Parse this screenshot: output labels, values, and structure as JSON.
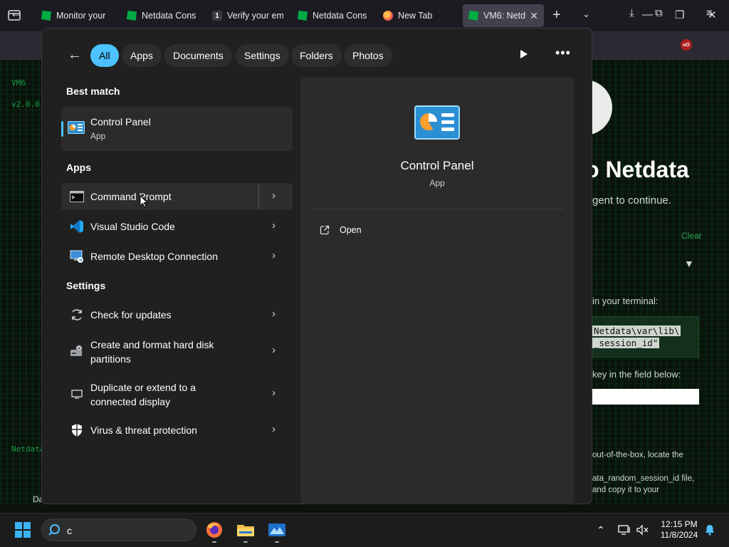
{
  "browser": {
    "tabs": [
      {
        "title": "Monitor your",
        "icon": "netdata-favicon",
        "close": ""
      },
      {
        "title": "Netdata Cons",
        "icon": "netdata-favicon",
        "close": ""
      },
      {
        "title": "Verify your em",
        "icon": "number-favicon",
        "badge": "1",
        "close": ""
      },
      {
        "title": "Netdata Cons",
        "icon": "netdata-favicon",
        "close": ""
      },
      {
        "title": "New Tab",
        "icon": "firefox-favicon",
        "close": ""
      },
      {
        "title": "VM6: Netda",
        "icon": "netdata-favicon",
        "close": "✕"
      }
    ],
    "new_tab_symbol": "+",
    "list_all_tabs_symbol": "⌄",
    "back_symbol": "←",
    "win_minimize": "—",
    "win_restore": "❐",
    "win_close": "✕",
    "download_symbol": "⤓",
    "extensions_symbol": "⧉",
    "ublock_badge": "uO",
    "menu_symbol": "≡"
  },
  "webpage": {
    "side_vm": "VM6",
    "side_version": "v2.0.0",
    "side_footer": "Netdata",
    "side_bottom": "Da",
    "hero_title": "o Netdata",
    "hero_sub": "gent to continue.",
    "clear_link": "Clear",
    "dropdown_arrow": "▼",
    "terminal_label": "in your terminal:",
    "code_line1": "Netdata\\var\\lib\\",
    "code_line2": "_session_id\"",
    "key_label": "key in the field below:",
    "note_line1": "out-of-the-box, locate the",
    "note_line2": "ata_random_session_id file,",
    "note_line3": "and copy it to your"
  },
  "search": {
    "back_symbol": "←",
    "filters": [
      "All",
      "Apps",
      "Documents",
      "Settings",
      "Folders",
      "Photos"
    ],
    "more_symbol": "•••",
    "best_match": {
      "heading": "Best match",
      "title": "Control Panel",
      "type": "App"
    },
    "apps_heading": "Apps",
    "apps": [
      {
        "label": "Command Prompt",
        "icon": "command-prompt-icon"
      },
      {
        "label": "Visual Studio Code",
        "icon": "vscode-icon"
      },
      {
        "label": "Remote Desktop Connection",
        "icon": "remote-desktop-icon"
      }
    ],
    "settings_heading": "Settings",
    "settings": [
      {
        "label": "Check for updates",
        "icon": "refresh-icon"
      },
      {
        "label": "Create and format hard disk partitions",
        "icon": "disk-management-icon"
      },
      {
        "label": "Duplicate or extend to a connected display",
        "icon": "display-icon"
      },
      {
        "label": "Virus & threat protection",
        "icon": "shield-icon"
      }
    ],
    "chevron_symbol": "›",
    "detail": {
      "title": "Control Panel",
      "type": "App",
      "action": "Open"
    }
  },
  "taskbar": {
    "search_text": "c",
    "tray_chevron": "⌃",
    "time": "12:15 PM",
    "date": "11/8/2024"
  },
  "colors": {
    "accent": "#4cc2ff",
    "netdata_green": "#00ab44"
  }
}
